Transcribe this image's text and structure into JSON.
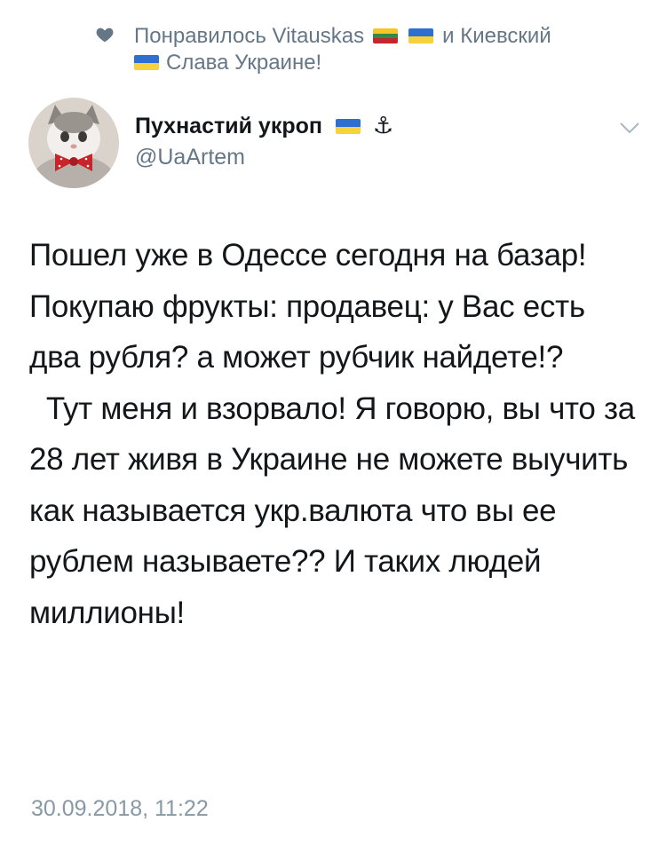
{
  "social_context": {
    "line1_prefix": "Понравилось Vitauskas",
    "line1_suffix": "и Киевский",
    "line2": "Слава Украине!"
  },
  "author": {
    "display_name": "Пухнастий укроп",
    "anchor_glyph": "⚓",
    "handle": "@UaArtem"
  },
  "tweet": {
    "text": "Пошел уже в Одессе сегодня на базар! Покупаю фрукты: продавец: у Вас есть два рубля? а может рубчик найдете!?\n  Тут меня и взорвало! Я говорю, вы что за 28 лет живя в Украине не можете выучить как называется укр.валюта что вы ее рублем называете?? И таких людей миллионы!",
    "timestamp": "30.09.2018, 11:22"
  },
  "colors": {
    "text_primary": "#14171a",
    "text_secondary": "#657786",
    "timestamp": "#8899a6"
  }
}
